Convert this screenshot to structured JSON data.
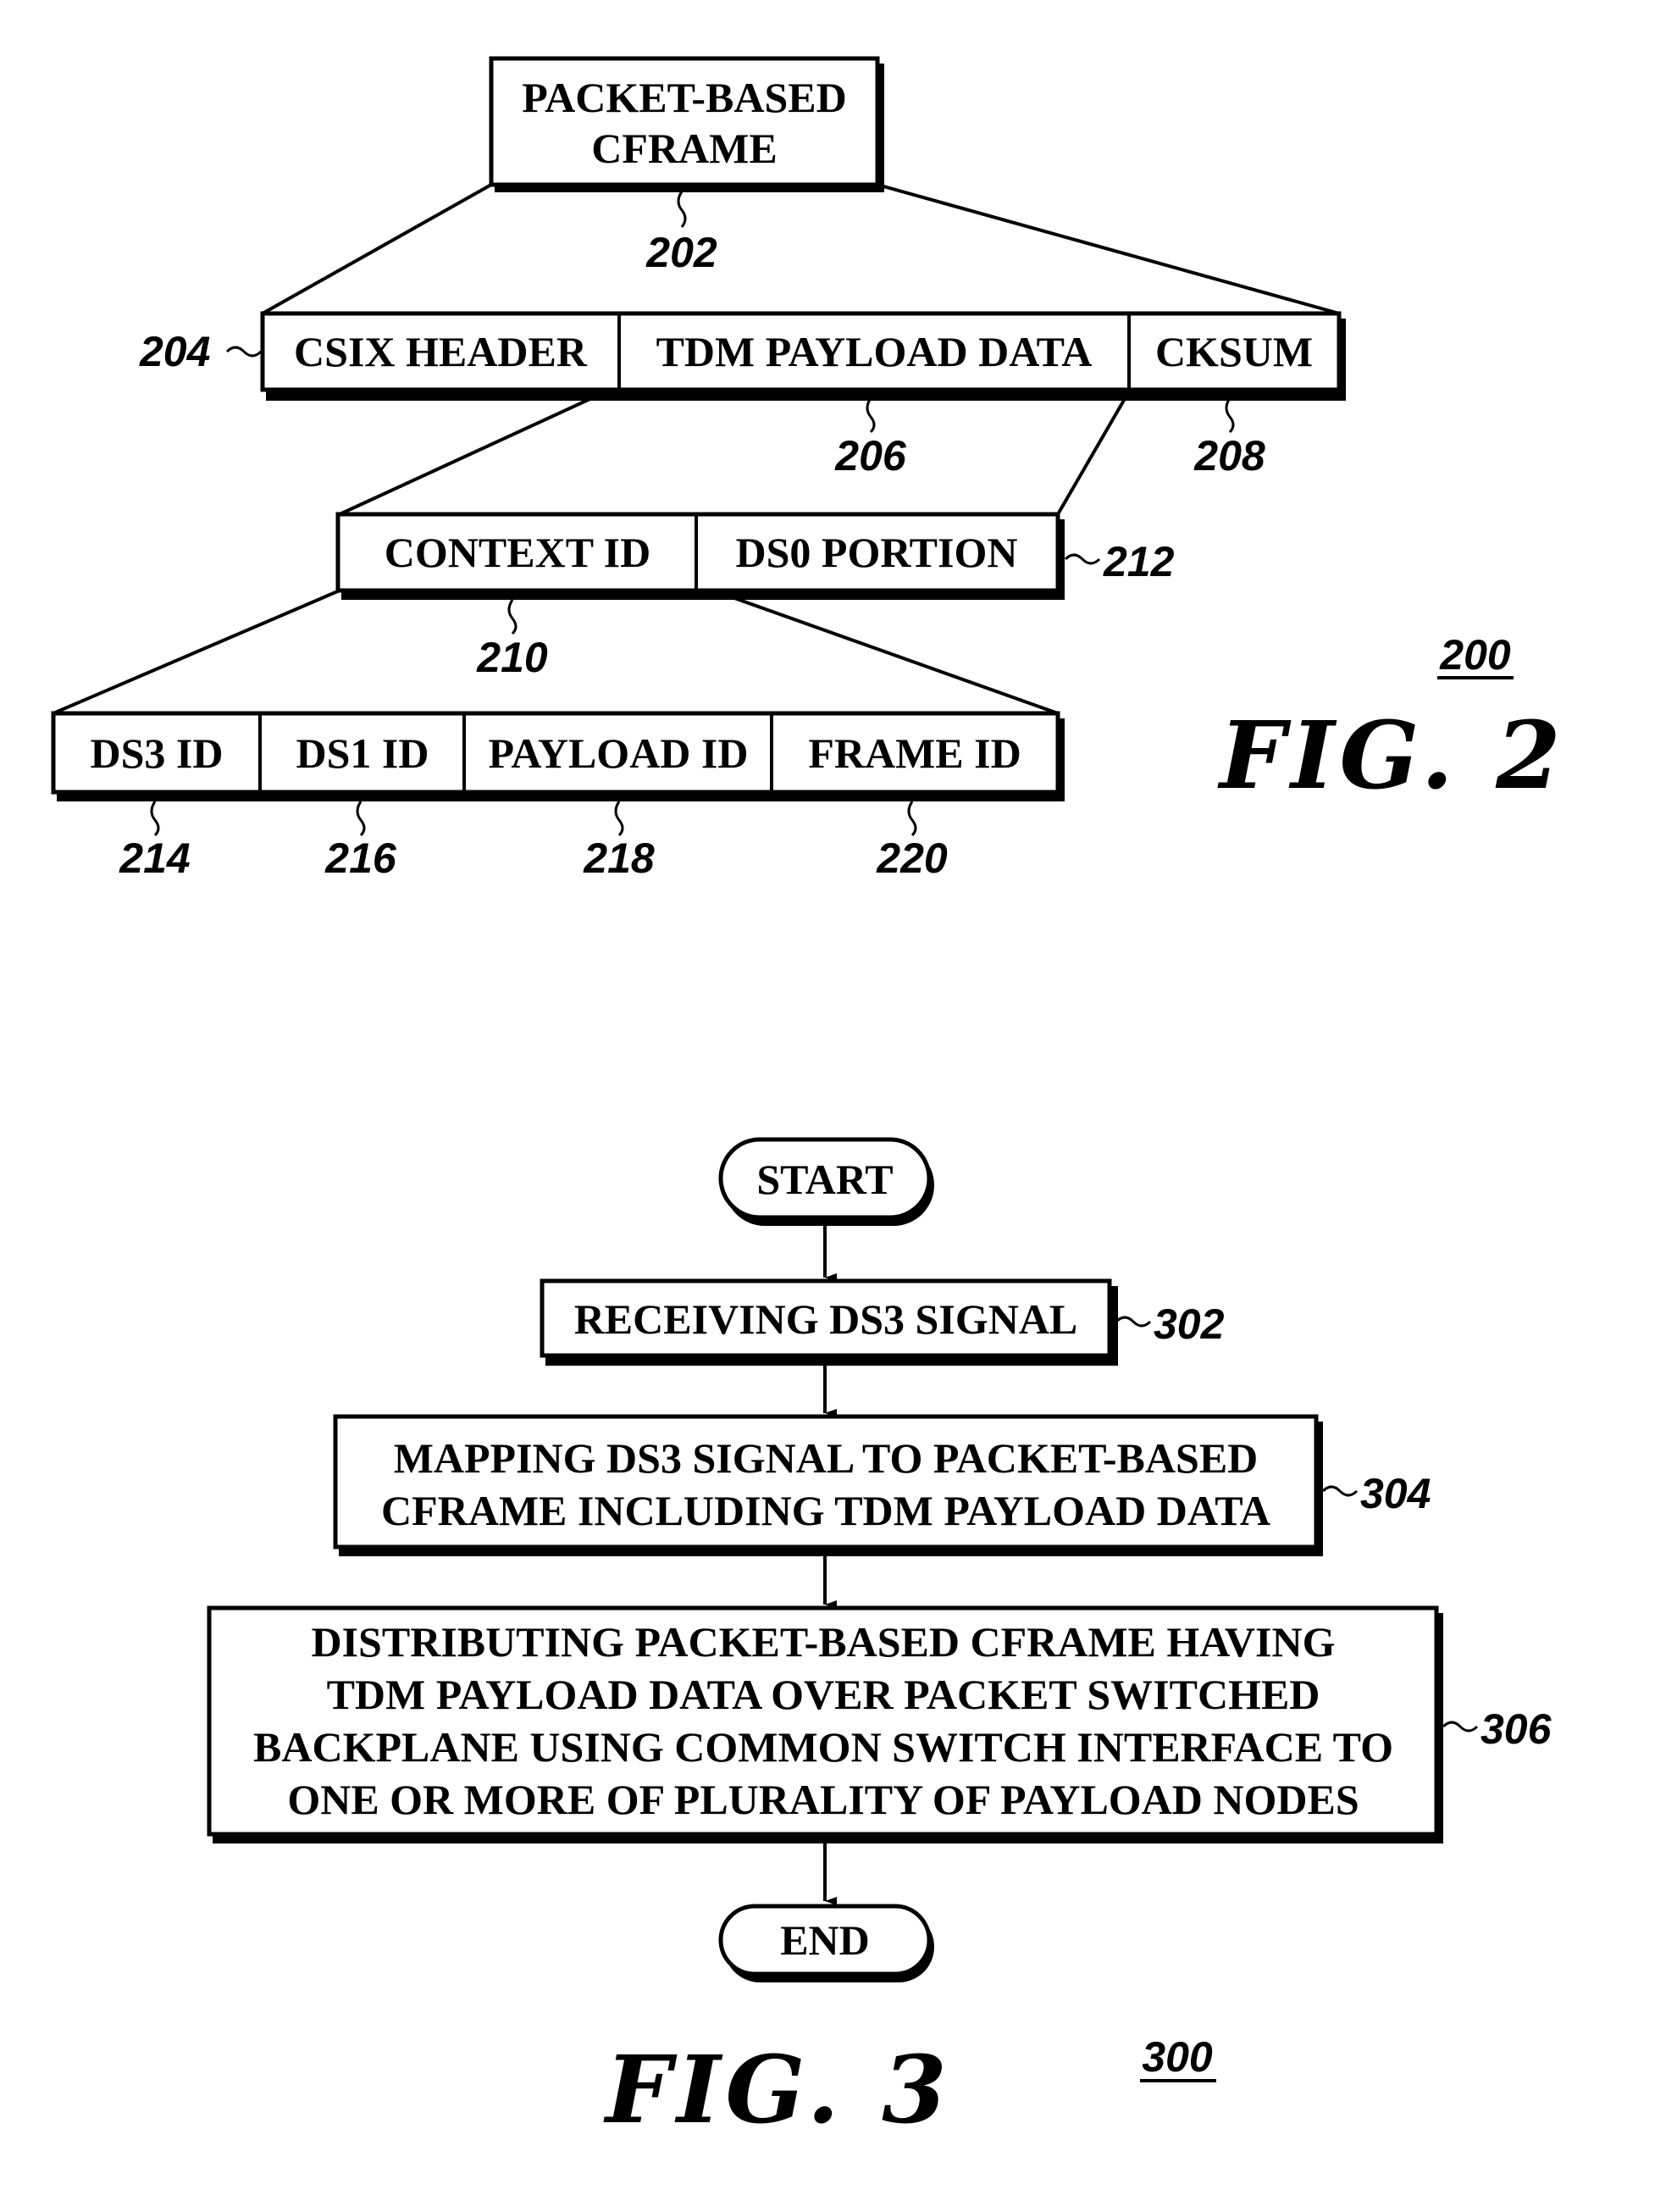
{
  "fig2": {
    "caption": "FIG. 2",
    "ref": "200",
    "top_box": {
      "lines": [
        "PACKET-BASED",
        "CFRAME"
      ],
      "ref": "202"
    },
    "row_frame": {
      "ref": "204",
      "cells": [
        {
          "label": "CSIX HEADER",
          "ref": ""
        },
        {
          "label": "TDM PAYLOAD DATA",
          "ref": "206"
        },
        {
          "label": "CKSUM",
          "ref": "208"
        }
      ]
    },
    "row_payload": {
      "ref": "212",
      "cells": [
        {
          "label": "CONTEXT ID",
          "ref": "210"
        },
        {
          "label": "DS0 PORTION",
          "ref": ""
        }
      ]
    },
    "row_context": {
      "cells": [
        {
          "label": "DS3 ID",
          "ref": "214"
        },
        {
          "label": "DS1 ID",
          "ref": "216"
        },
        {
          "label": "PAYLOAD ID",
          "ref": "218"
        },
        {
          "label": "FRAME ID",
          "ref": "220"
        }
      ]
    }
  },
  "fig3": {
    "caption": "FIG. 3",
    "ref": "300",
    "start": "START",
    "end": "END",
    "steps": [
      {
        "ref": "302",
        "lines": [
          "RECEIVING DS3 SIGNAL"
        ]
      },
      {
        "ref": "304",
        "lines": [
          "MAPPING DS3 SIGNAL TO PACKET-BASED",
          "CFRAME INCLUDING TDM PAYLOAD DATA"
        ]
      },
      {
        "ref": "306",
        "lines": [
          "DISTRIBUTING PACKET-BASED CFRAME HAVING",
          "TDM PAYLOAD DATA OVER PACKET SWITCHED",
          "BACKPLANE USING COMMON SWITCH INTERFACE TO",
          "ONE OR MORE OF PLURALITY OF PAYLOAD NODES"
        ]
      }
    ]
  }
}
